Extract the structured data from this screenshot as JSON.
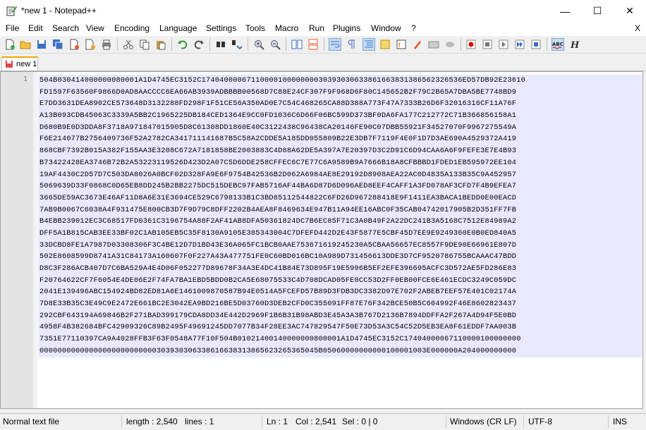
{
  "window": {
    "title": "*new 1 - Notepad++",
    "minimize": "—",
    "maximize": "☐",
    "close": "✕"
  },
  "menu": [
    "File",
    "Edit",
    "Search",
    "View",
    "Encoding",
    "Language",
    "Settings",
    "Tools",
    "Macro",
    "Run",
    "Plugins",
    "Window",
    "?"
  ],
  "menu_close": "X",
  "tabs": [
    {
      "label": "new 1"
    }
  ],
  "editor": {
    "line_number": "1",
    "lines": [
      "504B030414000000080001A1D4745EC3152C1740400006711000010000000030393030633861663831386562326536ED57DB92E23610",
      "FD1597F63560F9866D0AD8AACCCC6EA66AB3939ADBBBB00568D7C88E24CF307F9F968D6F80C145652B2F79C2B65A7DBA5BE7748BD9",
      "E7DD3631DEA8902CE573648D3132288FD298F1F51CE56A350AD0E7C54C468265CA88D388A773F47A7333B26D6F32016316CF11A76F",
      "A13B093CDB45063C3339A5BB2C1965225DB184CED1364E9CC0FD1036C6D66F06BC599D373BF0DA6FA177C212772C71B366856158A1",
      "D680B9E0D3DDA8F3718A971847015905D8C61308DD1860E40C3122438C96438CA20146FE90C07DBB55921F34527070F9967275549A",
      "F6E214077B2756409736F52A2782CA341711141687B5C58A2CDDE5A185DD055809B22E3DB7F7119F4E0F1D7D3AE690A4529372A419",
      "868CBF7392B015A382F155AA3E3208C672A7181858BE2003883C4D88A62DE5A397A7E20397D3C2D91C6D94CAA6A6F9FEFE3E7E4B93",
      "B73422428EA3746B72B2A53223119526D423D2A07C5D6DDE258CFFEC6C7E77C6A9589B9A7666B18A8CFBBBD1FDED1EB595972EE104",
      "19AF4430C2D57D7C503DA8026A0BCF02D328FA9E6F9754B42536B2D062A6984AE8E29192D8908AEA22AC0D4835A133B35C9A452957",
      "5069639D33F0868C0D65EB8DD245B2BB2275DC515DEBC97FAB5716AF44BA6D87D6D096AED8EEF4CAFF1A3FD078AF3CFD7F4B9EFEA7",
      "3665DE59AC3673E46AF11D8A6E31E3694CE529C6798133B1C3BD85112544822C6FD26D967288418E9F1411EA3BACA1BEDD0E00EACD",
      "7AB9B0067C6038A4F931475E800CB3D7F9D79C8DFF2202B4AEA8F8469634E947B11A94EE16ABC0F35CAB04742017905B2D351FF7FB",
      "B4EBB239012EC3C68517FD0361C3196754A88F2AF41AB8DFA50361824DC7B6EC85F71C3A0B49F2A22DC241B3A5168C7512E84989A2",
      "DFF5A1B815CAB3EE33BF02C1AB105EB5C35F8130A9105E385343004C7DFEFD442D2E43F5877E5CBF45D7EE9E9249360E0B0ED840A5",
      "33DCBD8FE1A7987D03308306F3C4BE12D7D1BD43E36A065FC1BCB0AAE753671619245230A5CBAA56657EC8557F9DE90E66961E807D",
      "502E8608599D8741A31C84173A160607F0F227A43A477751FE0C60BD016BC10A989D731456613DDE3D7CF9520786755BCAAAC47BDD",
      "D8C3F286ACB407D7C6BA529A4E4D06F052277D89678F34A3E4DC41B84E73D895F19E5996B5EF2EFE396695ACFC3D572AE5FD286E83",
      "F20764622CF7F6054E4DE06E2F74FA7BA1EBD5BDD0B2CA5E68075533C4D708DCAD05FE0CC53D2FF0EB00FCE6E461ECDC3249C059DC",
      "2041E139496ABC154924BD82ED81A6E1461009870587B94E0514A5FCEFD57B89D3FDB3DC3382D97E702F2ABEB7EEF57E401C02174A",
      "7D8E33B35C3E49C9E2472E661BC2E3042EA9BD216BE5D03760D3DEB2CFD0C355091FF87E76F342BCE50B5C604992F46E8602823437",
      "292CBF643194A69846B2F271BAD399179CDA8DD34E442D2969F1B6B31B98ABD3E45A3A3B767D2136B7894DDFFA2F267A4D94F5E0BD",
      "4958F4B382684BFC42909326C89B2495F49691245DD7077B34F28EE3AC747829547F50E73D53A3C54C52D5EB3EA8F61EDDF7AA003B",
      "7351E77110397CA9A4028FFB3F63F0548A77F10F504B01021400140000000800001A1D4745EC3152C17404000067110000100000000",
      "00000000000000000000000000303930306338616638313865623265365045B05060000000000100001003E000000A204000000000"
    ]
  },
  "status": {
    "type": "Normal text file",
    "length": "length : 2,540",
    "lines": "lines : 1",
    "ln": "Ln : 1",
    "col": "Col : 2,541",
    "sel": "Sel : 0 | 0",
    "eol": "Windows (CR LF)",
    "encoding": "UTF-8",
    "mode": "INS"
  },
  "colors": {
    "tab_accent": "#f7a500",
    "selection": "#e8e8ff",
    "gutter": "#e4e4e4"
  },
  "icons": [
    "new-icon",
    "open-icon",
    "save-icon",
    "save-all-icon",
    "close-icon",
    "close-all-icon",
    "print-icon",
    "cut-icon",
    "copy-icon",
    "paste-icon",
    "undo-icon",
    "redo-icon",
    "find-icon",
    "replace-icon",
    "zoom-in-icon",
    "zoom-out-icon",
    "sync-v-icon",
    "sync-h-icon",
    "word-wrap-icon",
    "all-chars-icon",
    "indent-guide-icon",
    "doc-map-icon",
    "function-list-icon",
    "folder-workspace-icon",
    "monitoring-icon",
    "record-macro-icon",
    "stop-macro-icon",
    "play-macro-icon",
    "run-macro-multiple-icon",
    "save-macro-icon",
    "spell-check-icon",
    "hex-icon"
  ]
}
